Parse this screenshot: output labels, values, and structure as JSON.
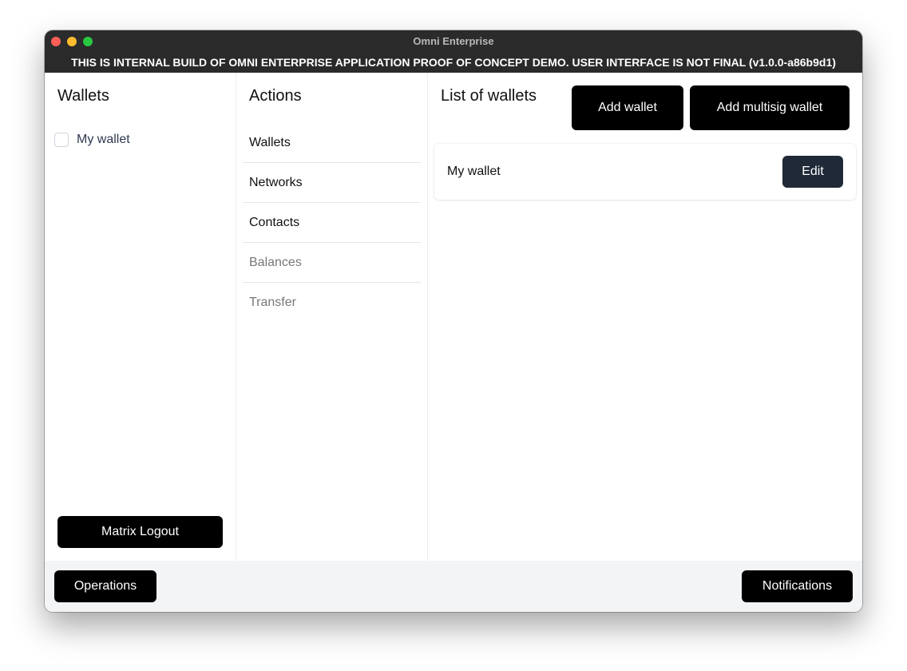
{
  "window": {
    "title": "Omni Enterprise",
    "banner": "THIS IS INTERNAL BUILD OF OMNI ENTERPRISE APPLICATION PROOF OF CONCEPT DEMO. USER INTERFACE IS NOT FINAL (v1.0.0-a86b9d1)"
  },
  "wallets_panel": {
    "heading": "Wallets",
    "items": [
      {
        "label": "My wallet",
        "checked": false
      }
    ],
    "logout_label": "Matrix Logout"
  },
  "actions_panel": {
    "heading": "Actions",
    "items": [
      {
        "label": "Wallets",
        "enabled": true
      },
      {
        "label": "Networks",
        "enabled": true
      },
      {
        "label": "Contacts",
        "enabled": true
      },
      {
        "label": "Balances",
        "enabled": false
      },
      {
        "label": "Transfer",
        "enabled": false
      }
    ]
  },
  "list_panel": {
    "heading": "List of wallets",
    "add_wallet_label": "Add wallet",
    "add_multisig_label": "Add multisig wallet",
    "wallets": [
      {
        "name": "My wallet",
        "edit_label": "Edit"
      }
    ]
  },
  "footer": {
    "operations_label": "Operations",
    "notifications_label": "Notifications"
  },
  "colors": {
    "button_primary": "#000000",
    "button_edit": "#1f2937",
    "titlebar": "#2b2b2b",
    "footer_bg": "#f3f4f6"
  }
}
